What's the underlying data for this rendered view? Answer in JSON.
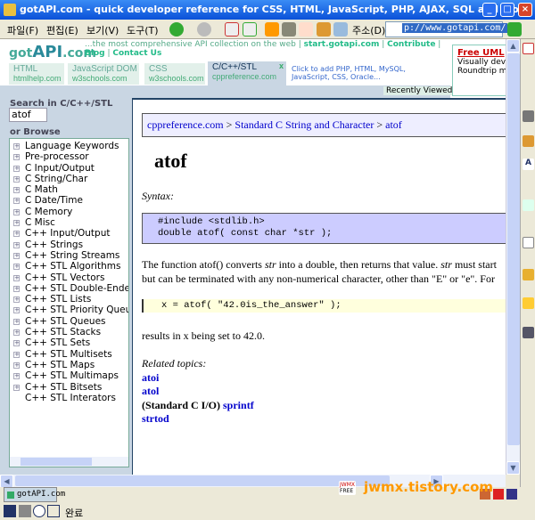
{
  "window": {
    "title": "gotAPI.com - quick developer reference for CSS, HTML, JavaScript, PHP, AJAX, SQL and more - jwBrowser"
  },
  "menu": [
    "파일(F)",
    "편집(E)",
    "보기(V)",
    "도구(T)"
  ],
  "address": {
    "label": "주소(D)",
    "value": "p://www.gotapi.com/"
  },
  "site": {
    "logo_small": "got",
    "logo_big": "API",
    "logo_suffix": ".com",
    "tagline": "...the most comprehensive API collection on the web |",
    "links": [
      "start.gotapi.com",
      "Contribute",
      "Blog",
      "Contact Us"
    ],
    "tabs": [
      {
        "label": "HTML",
        "sub": "htmlhelp.com"
      },
      {
        "label": "JavaScript DOM",
        "sub": "w3schools.com"
      },
      {
        "label": "CSS",
        "sub": "w3schools.com"
      },
      {
        "label": "C/C++/STL",
        "sub": "cppreference.com",
        "active": true
      }
    ],
    "tab_close": "x",
    "add_text": "Click to add PHP, HTML, MySQL, JavaScript, CSS, Oracle...",
    "recently_viewed": "Recently Viewed",
    "ad": {
      "title": "Free UML",
      "line1": "Visually dev",
      "line2": "Roundtrip m"
    }
  },
  "sidebar": {
    "search_label": "Search in C/C++/STL",
    "search_value": "atof",
    "browse_label": "or Browse",
    "items": [
      "Language Keywords",
      "Pre-processor",
      "C Input/Output",
      "C String/Char",
      "C Math",
      "C Date/Time",
      "C Memory",
      "C Misc",
      "C++ Input/Output",
      "C++ Strings",
      "C++ String Streams",
      "C++ STL Algorithms",
      "C++ STL Vectors",
      "C++ STL Double-Ended Queues",
      "C++ STL Lists",
      "C++ STL Priority Queues",
      "C++ STL Queues",
      "C++ STL Stacks",
      "C++ STL Sets",
      "C++ STL Multisets",
      "C++ STL Maps",
      "C++ STL Multimaps",
      "C++ STL Bitsets",
      "C++ STL Interators"
    ]
  },
  "doc": {
    "crumb": [
      "cppreference.com",
      "Standard C String and Character",
      "atof"
    ],
    "sep": " > ",
    "title": "atof",
    "syntax_label": "Syntax:",
    "syntax": [
      "#include <stdlib.h>",
      "double atof( const char *str );"
    ],
    "para1a": "The function atof() converts ",
    "str": "str",
    "para1b": " into a double, then returns that value. ",
    "para1c": " must start",
    "para2": "but can be terminated with any non-numerical character, other than \"E\" or \"e\". For",
    "example": "x = atof( \"42.0is_the_answer\" );",
    "result": "results in x being set to 42.0.",
    "related_label": "Related topics:",
    "related": {
      "atoi": "atoi",
      "atol": "atol",
      "stdio": "(Standard C I/O) ",
      "sprintf": "sprintf",
      "strtod": "strtod"
    }
  },
  "tabbar": {
    "tab": "gotAPI.com"
  },
  "status": {
    "text": "완료"
  },
  "watermark": {
    "badge1": "JWMX",
    "badge2": "FREE",
    "text": "jwmx.tistory.com"
  }
}
